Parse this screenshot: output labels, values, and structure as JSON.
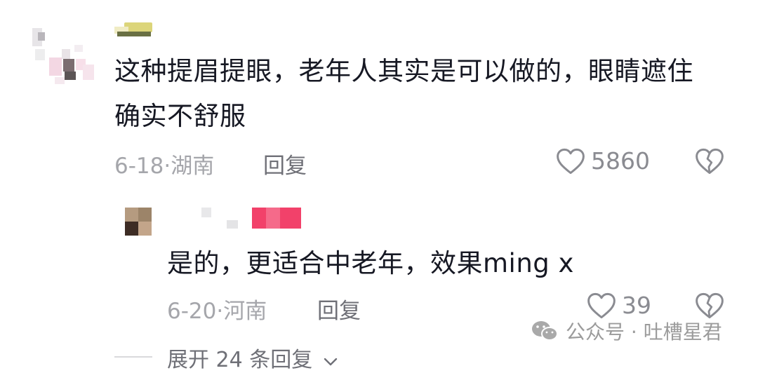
{
  "comment": {
    "text_line1": "这种提眉提眼，老年人其实是可以做的，眼睛遮住",
    "text_line2": "确实不舒服",
    "meta": "6-18·湖南",
    "reply_label": "回复",
    "like_count": "5860"
  },
  "reply": {
    "text": "是的，更适合中老年，效果ming x",
    "meta": "6-20·河南",
    "reply_label": "回复",
    "like_count": "39"
  },
  "expand_label": "展开 24 条回复",
  "watermark": "公众号 · 吐槽星君",
  "icons": {
    "like": "heart-outline-icon",
    "dislike": "broken-heart-icon",
    "expand": "chevron-down-icon",
    "watermark": "wechat-icon"
  },
  "colors": {
    "text": "#161823",
    "meta": "#a5a6ab",
    "reply": "#6f7077",
    "accent_pink": "#f2416a"
  }
}
